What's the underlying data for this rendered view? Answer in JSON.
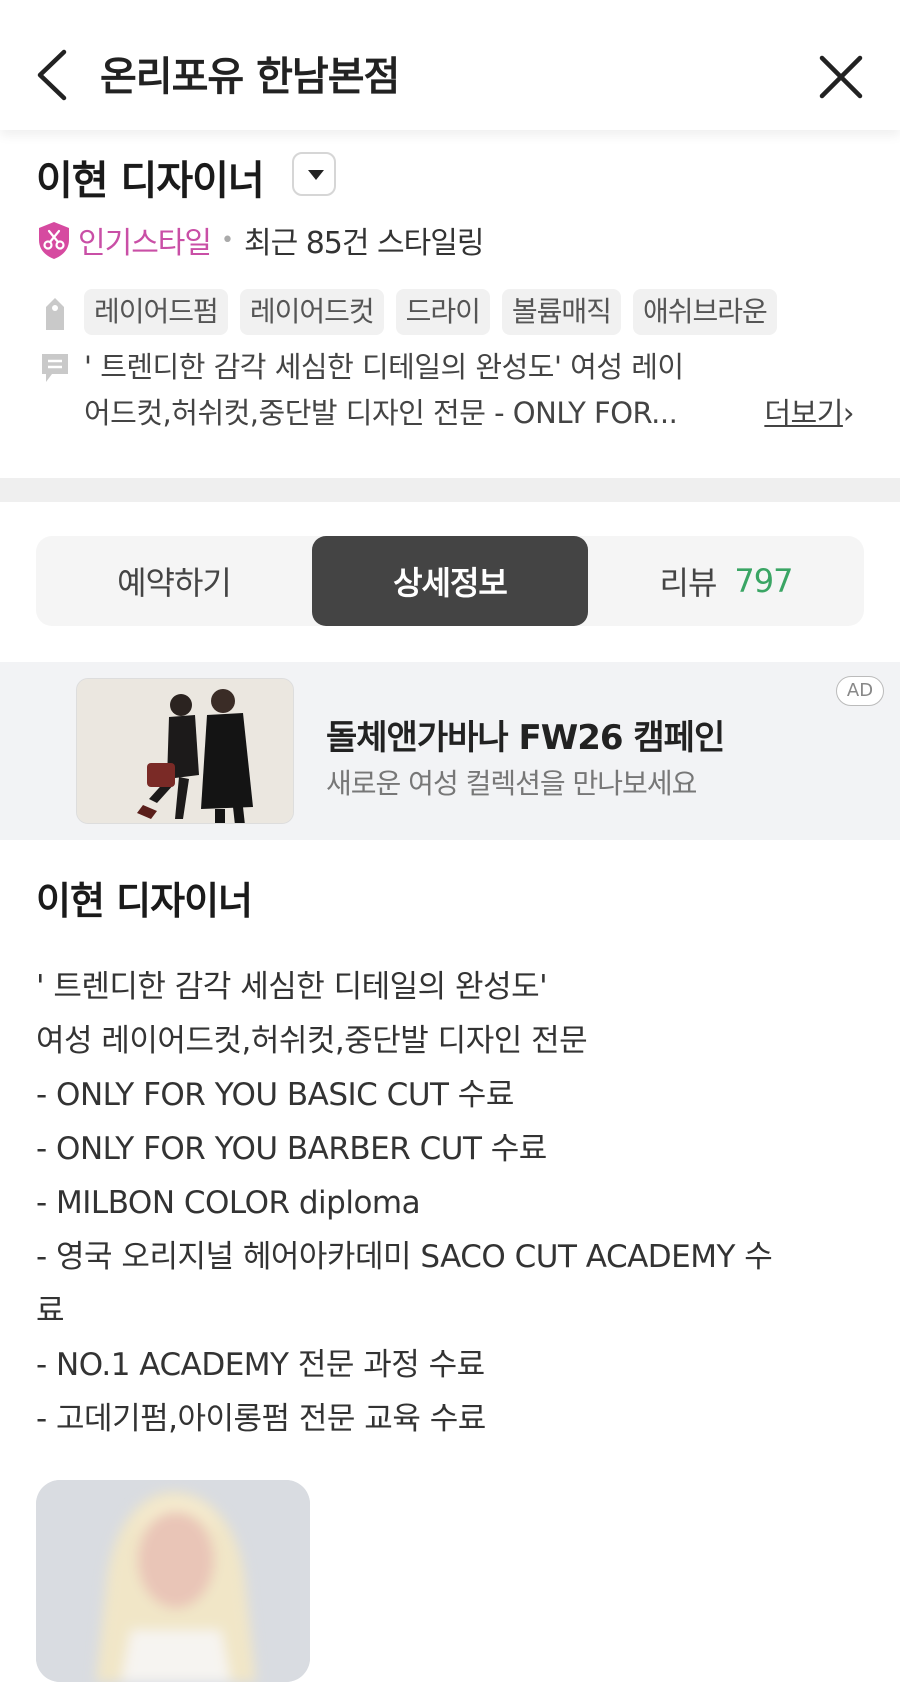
{
  "header": {
    "title": "온리포유 한남본점"
  },
  "designer": {
    "name": "이현 디자이너",
    "badge_label": "인기스타일",
    "separator": "•",
    "recent_styling": "최근 85건 스타일링"
  },
  "tags": [
    "레이어드펌",
    "레이어드컷",
    "드라이",
    "볼륨매직",
    "애쉬브라운"
  ],
  "intro": {
    "line1": "' 트렌디한 감각 세심한 디테일의 완성도' 여성 레이",
    "line2": "어드컷,허쉬컷,중단발 디자인 전문 - ONLY FOR...",
    "more_label": "더보기",
    "more_arrow": "›"
  },
  "tabs": [
    {
      "label": "예약하기",
      "active": false
    },
    {
      "label": "상세정보",
      "active": true
    },
    {
      "label": "리뷰",
      "count": "797",
      "active": false
    }
  ],
  "ad": {
    "title": "돌체앤가바나 FW26 캠페인",
    "subtitle": "새로운 여성 컬렉션을 만나보세요",
    "badge": "AD"
  },
  "detail": {
    "title": "이현 디자이너",
    "lines": [
      "' 트렌디한 감각 세심한 디테일의 완성도'",
      "여성 레이어드컷,허쉬컷,중단발 디자인 전문",
      "- ONLY FOR YOU BASIC CUT 수료",
      "- ONLY FOR YOU BARBER CUT 수료",
      "- MILBON COLOR diploma",
      "- 영국 오리지널 헤어아카데미 SACO CUT ACADEMY 수",
      "료",
      "- NO.1 ACADEMY 전문 과정 수료",
      "- 고데기펌,아이롱펌 전문 교육 수료"
    ]
  },
  "colors": {
    "accent_pink": "#c94fa6",
    "active_tab": "#444444",
    "review_green": "#3aa564"
  },
  "icons": {
    "back": "chevron-left-icon",
    "close": "close-icon",
    "dropdown": "caret-down-icon",
    "badge": "scissors-shield-icon",
    "tag": "tag-icon",
    "memo": "memo-icon"
  }
}
